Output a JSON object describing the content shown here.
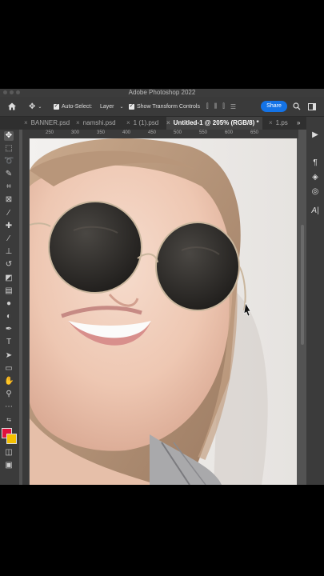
{
  "window": {
    "title": "Adobe Photoshop 2022"
  },
  "options_bar": {
    "auto_select_label": "Auto-Select:",
    "auto_select_value": "Layer",
    "show_transform_label": "Show Transform Controls",
    "share_label": "Share"
  },
  "tabs": [
    {
      "label": "BANNER.psd"
    },
    {
      "label": "namshi.psd"
    },
    {
      "label": "1 (1).psd"
    },
    {
      "label": "Untitled-1 @ 205% (RGB/8) *"
    },
    {
      "label": "1.ps"
    }
  ],
  "ruler_ticks": [
    "250",
    "300",
    "350",
    "400",
    "450",
    "500",
    "550",
    "600",
    "650"
  ],
  "tools": [
    "move-tool",
    "marquee-tool",
    "lasso-tool",
    "quick-select-tool",
    "crop-tool",
    "frame-tool",
    "eyedropper-tool",
    "healing-tool",
    "brush-tool",
    "stamp-tool",
    "history-brush-tool",
    "eraser-tool",
    "gradient-tool",
    "blur-tool",
    "dodge-tool",
    "pen-tool",
    "type-tool",
    "path-select-tool",
    "shape-tool",
    "hand-tool",
    "zoom-tool",
    "more-tools"
  ],
  "colors": {
    "foreground": "#e0103c",
    "background": "#f5c000",
    "share": "#1473e6"
  }
}
